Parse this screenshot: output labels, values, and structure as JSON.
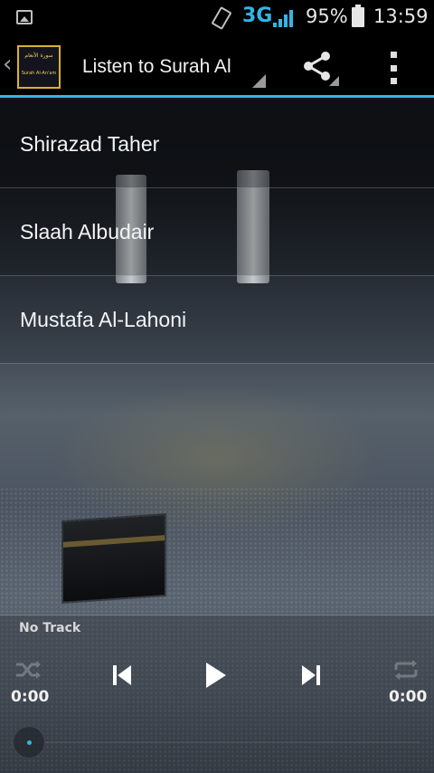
{
  "status_bar": {
    "network": "3G",
    "battery": "95%",
    "time": "13:59"
  },
  "action_bar": {
    "app_icon_text_top": "سورة الأنعام",
    "app_icon_text_bottom": "Surah Al-An'am",
    "title": "Listen to Surah Al",
    "icons": [
      "up-caret-icon",
      "share-icon",
      "overflow-menu-icon"
    ]
  },
  "reciters": [
    {
      "label": "Shirazad Taher"
    },
    {
      "label": "Slaah Albudair"
    },
    {
      "label": "Mustafa Al-Lahoni"
    }
  ],
  "player": {
    "track": "No Track",
    "elapsed": "0:00",
    "duration": "0:00",
    "controls": [
      "shuffle-icon",
      "previous-icon",
      "play-icon",
      "next-icon",
      "repeat-icon"
    ]
  },
  "colors": {
    "accent": "#33b5e5",
    "action_bar_bg": "#000000",
    "text": "#f4f4f4"
  }
}
